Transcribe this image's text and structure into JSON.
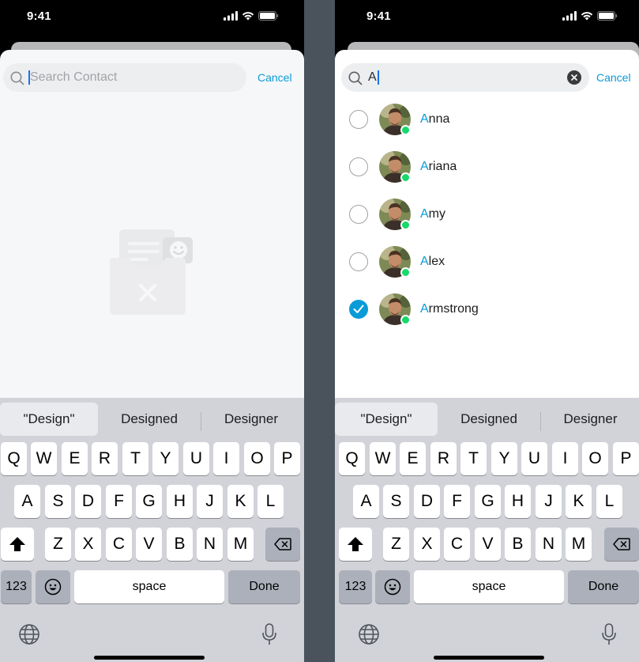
{
  "colors": {
    "accent": "#0a9bd8",
    "online": "#17d86a",
    "keyboard_bg": "#d1d3d9"
  },
  "status_bar": {
    "time": "9:41",
    "icons": [
      "signal-icon",
      "wifi-icon",
      "battery-icon"
    ]
  },
  "screens": {
    "empty": {
      "search_placeholder": "Search Contact",
      "cancel_label": "Cancel",
      "illustration": "empty-contacts-illustration"
    },
    "results": {
      "search_query": "A",
      "cancel_label": "Cancel",
      "contacts": [
        {
          "highlight": "A",
          "rest": "nna",
          "selected": false,
          "online": true
        },
        {
          "highlight": "A",
          "rest": "riana",
          "selected": false,
          "online": true
        },
        {
          "highlight": "A",
          "rest": "my",
          "selected": false,
          "online": true
        },
        {
          "highlight": "A",
          "rest": "lex",
          "selected": false,
          "online": true
        },
        {
          "highlight": "A",
          "rest": "rmstrong",
          "selected": true,
          "online": true
        }
      ]
    }
  },
  "keyboard": {
    "suggestions": [
      "\"Design\"",
      "Designed",
      "Designer"
    ],
    "row1": [
      "Q",
      "W",
      "E",
      "R",
      "T",
      "Y",
      "U",
      "I",
      "O",
      "P"
    ],
    "row2": [
      "A",
      "S",
      "D",
      "F",
      "G",
      "H",
      "J",
      "K",
      "L"
    ],
    "row3": [
      "Z",
      "X",
      "C",
      "V",
      "B",
      "N",
      "M"
    ],
    "numbers_label": "123",
    "space_label": "space",
    "done_label": "Done",
    "icons": [
      "shift-icon",
      "backspace-icon",
      "emoji-icon",
      "globe-icon",
      "microphone-icon"
    ]
  }
}
